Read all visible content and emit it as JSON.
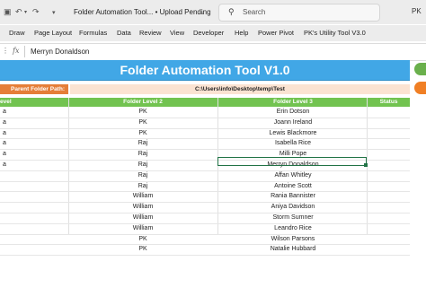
{
  "titlebar": {
    "document_title": "Folder Automation Tool... • Upload Pending",
    "search_placeholder": "Search",
    "user_initials": "PK"
  },
  "menu": [
    "Draw",
    "Page Layout",
    "Formulas",
    "Data",
    "Review",
    "View",
    "Developer",
    "Help",
    "Power Pivot",
    "PK's Utility Tool V3.0"
  ],
  "formula_bar": {
    "value": "Merryn Donaldson"
  },
  "sheet": {
    "title": "Folder Automation Tool V1.0",
    "parent_path_label": "Parent Folder Path:",
    "parent_path_value": "C:\\Users\\info\\Desktop\\temp\\Test",
    "headers": [
      "evel 1",
      "Folder Level 2",
      "Folder Level 3",
      "Status"
    ],
    "rows": [
      [
        "a",
        "PK",
        "Erin Dotson",
        ""
      ],
      [
        "a",
        "PK",
        "Joann Ireland",
        ""
      ],
      [
        "a",
        "PK",
        "Lewis Blackmore",
        ""
      ],
      [
        "a",
        "Raj",
        "Isabella Rice",
        ""
      ],
      [
        "a",
        "Raj",
        "Milli Pope",
        ""
      ],
      [
        "a",
        "Raj",
        "Merryn Donaldson",
        ""
      ],
      [
        "",
        "Raj",
        "Affan Whitley",
        ""
      ],
      [
        "",
        "Raj",
        "Antoine Scott",
        ""
      ],
      [
        "",
        "William",
        "Rania Bannister",
        ""
      ],
      [
        "",
        "William",
        "Aniya Davidson",
        ""
      ],
      [
        "",
        "William",
        "Storm Sumner",
        ""
      ],
      [
        "",
        "William",
        "Leandro Rice",
        ""
      ],
      [
        "",
        "PK",
        "Wilson Parsons",
        ""
      ],
      [
        "",
        "PK",
        "Natalie Hubbard",
        ""
      ]
    ]
  },
  "colors": {
    "title_band": "#41a7e6",
    "header_row": "#72c350",
    "path_label": "#e57e38",
    "path_value_bg": "#fbe3d2",
    "button_green": "#6ab04c",
    "button_orange": "#f07f25",
    "selection": "#217346"
  },
  "icons": {
    "titlebar": [
      "save-icon",
      "undo-icon",
      "redo-icon",
      "chevron-down-icon"
    ],
    "search": "search-icon",
    "formula_bar": [
      "options-icon",
      "function-icon"
    ]
  }
}
